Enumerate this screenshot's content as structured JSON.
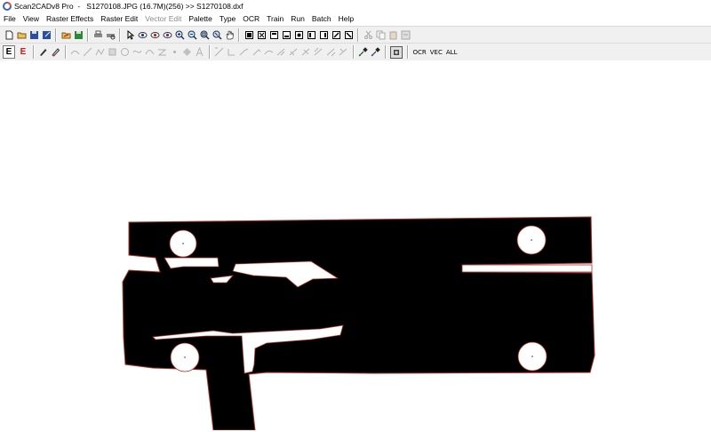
{
  "window": {
    "app_name": "Scan2CADv8 Pro",
    "document": "S1270108.JPG (16.7M)(256) >> S1270108.dxf"
  },
  "menu": [
    {
      "label": "File",
      "enabled": true
    },
    {
      "label": "View",
      "enabled": true
    },
    {
      "label": "Raster Effects",
      "enabled": true
    },
    {
      "label": "Raster Edit",
      "enabled": true
    },
    {
      "label": "Vector Edit",
      "enabled": false
    },
    {
      "label": "Palette",
      "enabled": true
    },
    {
      "label": "Type",
      "enabled": true
    },
    {
      "label": "OCR",
      "enabled": true
    },
    {
      "label": "Train",
      "enabled": true
    },
    {
      "label": "Run",
      "enabled": true
    },
    {
      "label": "Batch",
      "enabled": true
    },
    {
      "label": "Help",
      "enabled": true
    }
  ],
  "toolbar1": {
    "groups": [
      [
        "new-file-icon",
        "open-folder-icon",
        "save-icon",
        "save-as-icon"
      ],
      [
        "open-vector-icon",
        "save-vector-icon"
      ],
      [
        "print-icon",
        "print-preview-icon"
      ],
      [
        "pointer-icon",
        "view-raster-icon",
        "view-vector-icon",
        "view-both-icon",
        "zoom-in-icon",
        "zoom-out-icon",
        "zoom-fit-icon",
        "zoom-window-icon",
        "pan-hand-icon"
      ],
      [
        "select-black-icon",
        "select-region-icon",
        "frame-1-icon",
        "frame-2-icon",
        "frame-3-icon",
        "frame-4-icon",
        "frame-5-icon",
        "frame-6-icon",
        "frame-7-icon"
      ],
      [
        "cut-icon",
        "copy-icon",
        "paste-icon",
        "undo-icon"
      ]
    ],
    "disabled": [
      "cut-icon",
      "copy-icon",
      "paste-icon",
      "undo-icon"
    ]
  },
  "toolbar2": {
    "toggle_e_raster": "E",
    "toggle_e_vector": "E",
    "text_buttons": [
      "OCR",
      "VEC",
      "ALL"
    ]
  },
  "colors": {
    "toolbar_bg": "#f0f0f0",
    "canvas_bg": "#ffffff",
    "raster_fill": "#000000",
    "vector_outline": "#c0392b"
  }
}
